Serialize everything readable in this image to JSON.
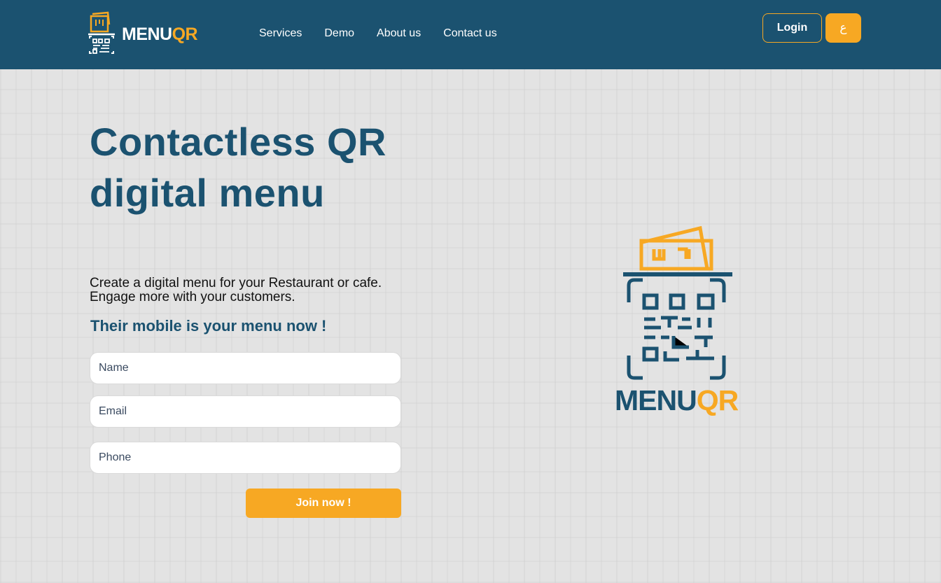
{
  "brand": {
    "name_part1": "MENU",
    "name_part2": "QR",
    "primary_color": "#1b5270",
    "accent_color": "#f7a823"
  },
  "nav": {
    "items": [
      {
        "label": "Services"
      },
      {
        "label": "Demo"
      },
      {
        "label": "About us"
      },
      {
        "label": "Contact us"
      }
    ]
  },
  "header": {
    "login_label": "Login",
    "language_label": "ع"
  },
  "hero": {
    "title": "Contactless QR digital menu",
    "description_line1": "Create a digital menu for your Restaurant or cafe.",
    "description_line2": "Engage more with your customers.",
    "tagline": "Their mobile is your menu now !"
  },
  "form": {
    "name_placeholder": "Name",
    "email_placeholder": "Email",
    "phone_placeholder": "Phone",
    "submit_label": "Join now !"
  },
  "icons": [
    "menuqr-logo-icon",
    "menuqr-large-logo-icon"
  ]
}
